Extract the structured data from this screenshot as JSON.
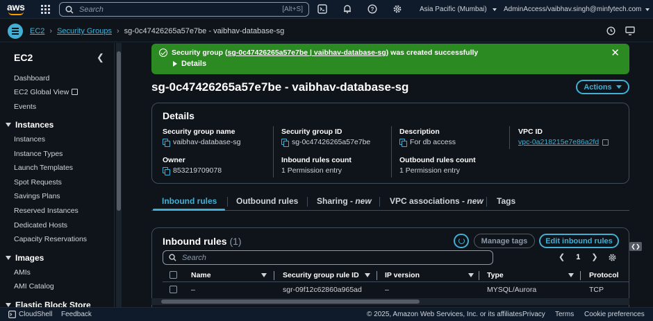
{
  "topnav": {
    "search_placeholder": "Search",
    "search_shortcut": "[Alt+S]",
    "region": "Asia Pacific (Mumbai)",
    "account": "AdminAccess/vaibhav.singh@minfytech.com"
  },
  "breadcrumb": {
    "items": [
      "EC2",
      "Security Groups"
    ],
    "current": "sg-0c47426265a57e7be - vaibhav-database-sg"
  },
  "sidebar": {
    "title": "EC2",
    "top_items": [
      "Dashboard",
      "EC2 Global View",
      "Events"
    ],
    "instances_section": "Instances",
    "instances_items": [
      "Instances",
      "Instance Types",
      "Launch Templates",
      "Spot Requests",
      "Savings Plans",
      "Reserved Instances",
      "Dedicated Hosts",
      "Capacity Reservations"
    ],
    "images_section": "Images",
    "images_items": [
      "AMIs",
      "AMI Catalog"
    ],
    "ebs_section": "Elastic Block Store"
  },
  "banner": {
    "prefix": "Security group (",
    "link": "sg-0c47426265a57e7be | vaibhav-database-sg",
    "suffix": ") was created successfully",
    "details": "Details"
  },
  "page": {
    "title": "sg-0c47426265a57e7be - vaibhav-database-sg",
    "actions": "Actions"
  },
  "details": {
    "title": "Details",
    "fields": [
      {
        "label": "Security group name",
        "value": "vaibhav-database-sg"
      },
      {
        "label": "Security group ID",
        "value": "sg-0c47426265a57e7be"
      },
      {
        "label": "Description",
        "value": "For db access"
      },
      {
        "label": "VPC ID",
        "value": "vpc-0a218215e7e86a2fd"
      },
      {
        "label": "Owner",
        "value": "853219709078"
      },
      {
        "label": "Inbound rules count",
        "value": "1 Permission entry"
      },
      {
        "label": "Outbound rules count",
        "value": "1 Permission entry"
      }
    ]
  },
  "tabs": [
    {
      "label": "Inbound rules",
      "suffix": ""
    },
    {
      "label": "Outbound rules",
      "suffix": ""
    },
    {
      "label": "Sharing - ",
      "suffix": "new"
    },
    {
      "label": "VPC associations - ",
      "suffix": "new"
    },
    {
      "label": "Tags",
      "suffix": ""
    }
  ],
  "inbound": {
    "title": "Inbound rules",
    "count": "(1)",
    "manage_tags": "Manage tags",
    "edit": "Edit inbound rules",
    "search_placeholder": "Search",
    "page": "1",
    "columns": [
      "Name",
      "Security group rule ID",
      "IP version",
      "Type",
      "Protocol"
    ],
    "rows": [
      {
        "name": "–",
        "rule_id": "sgr-09f12c62860a965ad",
        "ip_version": "–",
        "type": "MYSQL/Aurora",
        "protocol": "TCP"
      }
    ]
  },
  "footer": {
    "cloudshell": "CloudShell",
    "feedback": "Feedback",
    "copyright": "© 2025, Amazon Web Services, Inc. or its affiliates.",
    "privacy": "Privacy",
    "terms": "Terms",
    "cookies": "Cookie preferences"
  }
}
